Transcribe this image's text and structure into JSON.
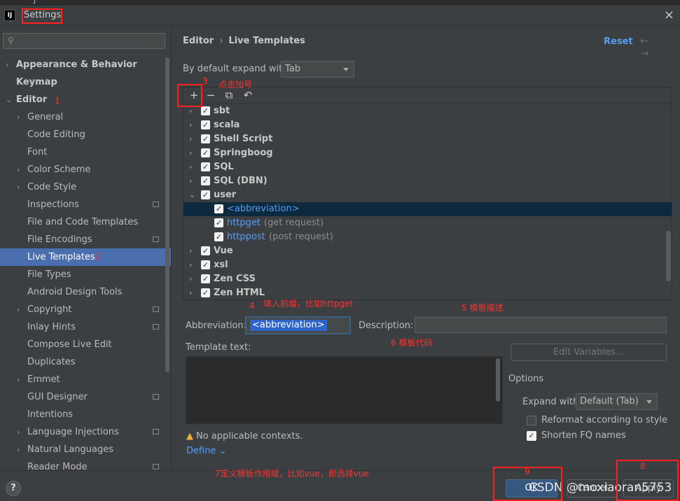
{
  "editor_hint": "}",
  "window": {
    "title": "Settings",
    "close": "×"
  },
  "sidebar": {
    "search_icon": "🔍",
    "items": [
      {
        "label": "Appearance & Behavior",
        "level": 0,
        "arrow": "›",
        "bold": true
      },
      {
        "label": "Keymap",
        "level": 0,
        "arrow": "",
        "bold": true
      },
      {
        "label": "Editor",
        "level": 0,
        "arrow": "⌄",
        "bold": true
      },
      {
        "label": "General",
        "level": 1,
        "arrow": "›"
      },
      {
        "label": "Code Editing",
        "level": 1,
        "arrow": ""
      },
      {
        "label": "Font",
        "level": 1,
        "arrow": ""
      },
      {
        "label": "Color Scheme",
        "level": 1,
        "arrow": "›"
      },
      {
        "label": "Code Style",
        "level": 1,
        "arrow": "›"
      },
      {
        "label": "Inspections",
        "level": 1,
        "arrow": "",
        "gear": true
      },
      {
        "label": "File and Code Templates",
        "level": 1,
        "arrow": ""
      },
      {
        "label": "File Encodings",
        "level": 1,
        "arrow": "",
        "gear": true
      },
      {
        "label": "Live Templates",
        "level": 1,
        "arrow": "",
        "selected": true
      },
      {
        "label": "File Types",
        "level": 1,
        "arrow": ""
      },
      {
        "label": "Android Design Tools",
        "level": 1,
        "arrow": ""
      },
      {
        "label": "Copyright",
        "level": 1,
        "arrow": "›",
        "gear": true
      },
      {
        "label": "Inlay Hints",
        "level": 1,
        "arrow": "",
        "gear": true
      },
      {
        "label": "Compose Live Edit",
        "level": 1,
        "arrow": ""
      },
      {
        "label": "Duplicates",
        "level": 1,
        "arrow": ""
      },
      {
        "label": "Emmet",
        "level": 1,
        "arrow": "›"
      },
      {
        "label": "GUI Designer",
        "level": 1,
        "arrow": "",
        "gear": true
      },
      {
        "label": "Intentions",
        "level": 1,
        "arrow": ""
      },
      {
        "label": "Language Injections",
        "level": 1,
        "arrow": "›",
        "gear": true
      },
      {
        "label": "Natural Languages",
        "level": 1,
        "arrow": "›"
      },
      {
        "label": "Reader Mode",
        "level": 1,
        "arrow": "",
        "gear": true
      }
    ]
  },
  "header": {
    "breadcrumb_root": "Editor",
    "breadcrumb_sep": "›",
    "breadcrumb_leaf": "Live Templates",
    "reset": "Reset",
    "nav": "← →"
  },
  "expand": {
    "label": "By default expand with",
    "value": "Tab"
  },
  "toolbar": {
    "add": "+",
    "remove": "−",
    "copy": "⧉",
    "revert": "↶"
  },
  "template_groups": [
    {
      "name": "sbt",
      "type": "group",
      "arrow": "›"
    },
    {
      "name": "scala",
      "type": "group",
      "arrow": "›"
    },
    {
      "name": "Shell Script",
      "type": "group",
      "arrow": "›"
    },
    {
      "name": "Springboog",
      "type": "group",
      "arrow": "›"
    },
    {
      "name": "SQL",
      "type": "group",
      "arrow": "›"
    },
    {
      "name": "SQL (DBN)",
      "type": "group",
      "arrow": "›"
    },
    {
      "name": "user",
      "type": "group",
      "arrow": "⌄"
    },
    {
      "name": "<abbreviation>",
      "type": "child",
      "desc": "",
      "selected": true
    },
    {
      "name": "httpget",
      "type": "child",
      "desc": "(get request)"
    },
    {
      "name": "httppost",
      "type": "child",
      "desc": "(post request)"
    },
    {
      "name": "Vue",
      "type": "group",
      "arrow": "›"
    },
    {
      "name": "xsl",
      "type": "group",
      "arrow": "›"
    },
    {
      "name": "Zen CSS",
      "type": "group",
      "arrow": "›"
    },
    {
      "name": "Zen HTML",
      "type": "group",
      "arrow": "›"
    }
  ],
  "form": {
    "abbreviation_label": "Abbreviation:",
    "abbreviation_value": "<abbreviation>",
    "description_label": "Description:",
    "description_value": "",
    "template_text_label": "Template text:",
    "edit_variables": "Edit Variables...",
    "options_title": "Options",
    "expand_with_label": "Expand with",
    "expand_with_value": "Default (Tab)",
    "reformat_label": "Reformat according to style",
    "reformat_checked": false,
    "shorten_label": "Shorten FQ names",
    "shorten_checked": true,
    "warning": "No applicable contexts.",
    "define": "Define ⌄"
  },
  "footer": {
    "help": "?",
    "ok": "OK",
    "cancel": "Cancel",
    "apply": "Apply"
  },
  "watermark": "CSDN @moxiaoran5753",
  "annotations": {
    "a1": "1",
    "a2": "2",
    "a3": "3",
    "a3_text": "点击加号",
    "a4": "4",
    "a4_text": "填入前缀，比如httpget",
    "a5": "5 模板描述",
    "a6": "6 模板代码",
    "a7": "7定义模板作用域，比如vue，即选择vue",
    "a8": "8",
    "a9": "9"
  },
  "colors": {
    "accent": "#4b6eaf",
    "link": "#589df6",
    "annotation": "#ff3030",
    "background": "#3c3f41"
  }
}
